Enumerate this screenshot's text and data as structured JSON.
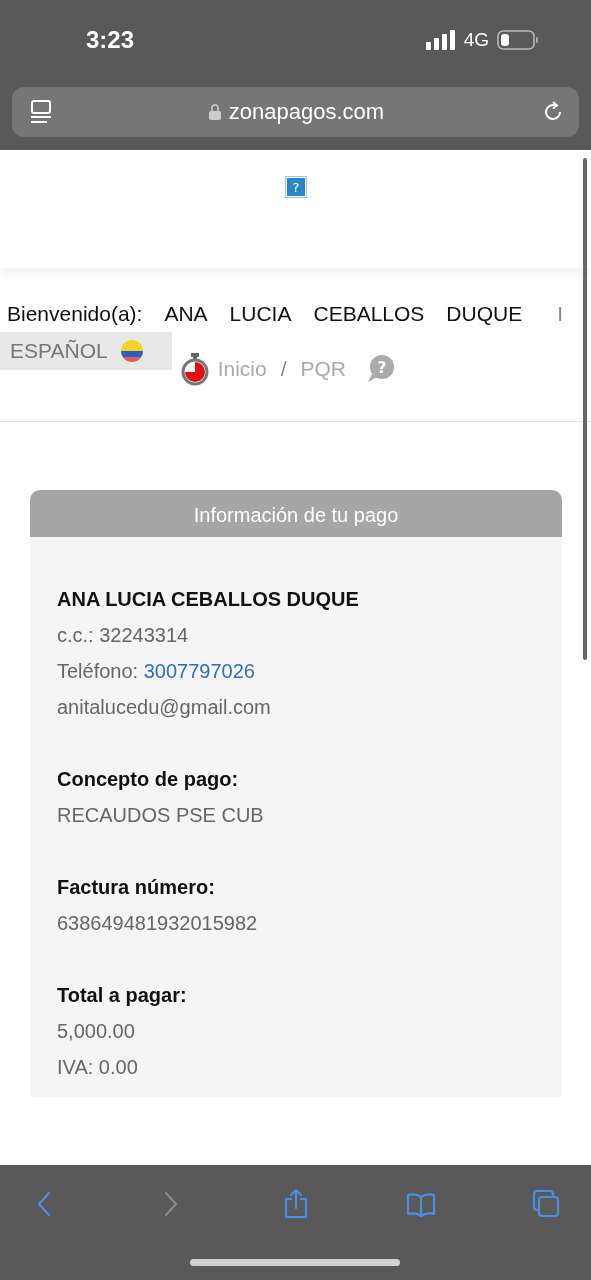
{
  "status_bar": {
    "time": "3:23",
    "network": "4G"
  },
  "address_bar": {
    "url": "zonapagos.com"
  },
  "header": {
    "image_glyph": "?",
    "help_glyph": "?",
    "welcome_label": "Bienvenido(a):",
    "user_names": [
      "ANA",
      "LUCIA",
      "CEBALLOS",
      "DUQUE"
    ],
    "separator": "I",
    "language": "ESPAÑOL",
    "breadcrumb": [
      {
        "label": "Inicio"
      },
      {
        "label": "PQR"
      }
    ],
    "breadcrumb_separator": "/"
  },
  "payment_card": {
    "title": "Información de tu pago",
    "sections": [
      {
        "lines": [
          {
            "kind": "heading",
            "text": "ANA LUCIA CEBALLOS DUQUE"
          },
          {
            "kind": "text",
            "text": "c.c.: 32243314"
          },
          {
            "kind": "link",
            "label": "Teléfono:",
            "text": "3007797026"
          },
          {
            "kind": "text",
            "text": "anitalucedu@gmail.com"
          }
        ]
      },
      {
        "lines": [
          {
            "kind": "heading",
            "text": "Concepto de pago:"
          },
          {
            "kind": "text",
            "text": "RECAUDOS PSE CUB"
          }
        ]
      },
      {
        "lines": [
          {
            "kind": "heading",
            "text": "Factura número:"
          },
          {
            "kind": "text",
            "text": "638649481932015982"
          }
        ]
      },
      {
        "lines": [
          {
            "kind": "heading",
            "text": "Total a pagar:"
          },
          {
            "kind": "text",
            "text": "5,000.00"
          },
          {
            "kind": "text",
            "text": "IVA: 0.00"
          }
        ]
      }
    ]
  },
  "toolbar": [
    {
      "kind": "back",
      "disabled": false
    },
    {
      "kind": "forward",
      "disabled": true
    },
    {
      "kind": "share",
      "disabled": false
    },
    {
      "kind": "bookmarks",
      "disabled": false
    },
    {
      "kind": "tabs",
      "disabled": false
    }
  ]
}
